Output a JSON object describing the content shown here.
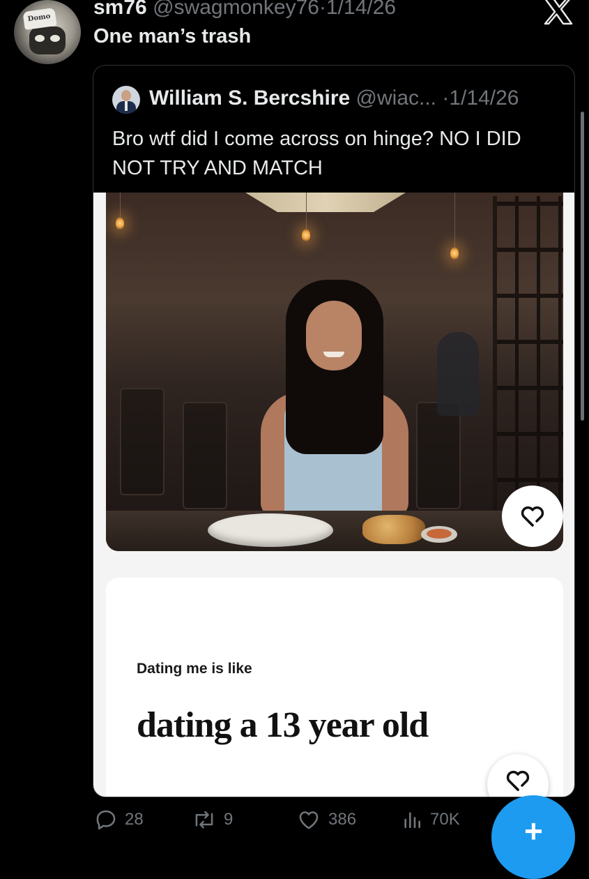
{
  "tweet": {
    "author_name": "sm76",
    "author_handle": "@swagmonkey76",
    "date": "1/14/26",
    "separator": "·",
    "text": "One man’s trash",
    "avatar_text": "Domo"
  },
  "quote": {
    "author_name": "William S. Bercshire",
    "author_handle_truncated": "@wiac...",
    "date": "1/14/26",
    "separator": "·",
    "text": "Bro wtf did I come across on hinge? NO I DID NOT TRY AND MATCH"
  },
  "hinge": {
    "prompt_label": "Dating me is like",
    "prompt_answer": "dating a 13 year old"
  },
  "actions": {
    "replies": "28",
    "reposts": "9",
    "likes": "386",
    "views": "70K"
  },
  "colors": {
    "background": "#000000",
    "text_primary": "#e7e9ea",
    "text_secondary": "#71767b",
    "accent": "#1d9bf0",
    "card_border": "#2f3336"
  },
  "icons": [
    "x-logo-icon",
    "reply-icon",
    "repost-icon",
    "like-icon",
    "views-icon",
    "plus-icon",
    "hinge-like-icon"
  ]
}
